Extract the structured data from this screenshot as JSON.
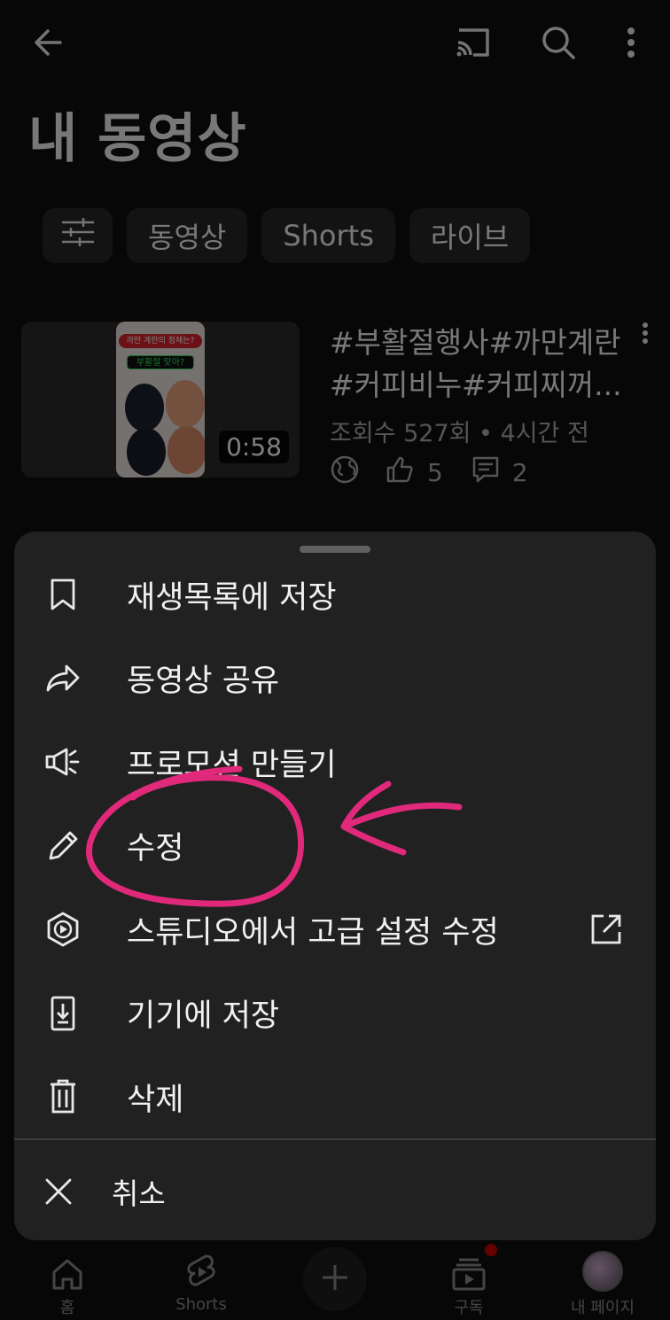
{
  "header": {
    "title": "내 동영상"
  },
  "chips": [
    "동영상",
    "Shorts",
    "라이브"
  ],
  "videos": [
    {
      "thumbnail_caption_1": "까만 계란의 정체는?",
      "thumbnail_caption_2": "부활절  맞아?",
      "duration": "0:58",
      "title": "#부활절행사#까만계란#커피비누#커피찌꺼...",
      "meta": "조회수 527회 • 4시간 전",
      "likes": "5",
      "comments": "2"
    }
  ],
  "menu": {
    "items": [
      {
        "label": "재생목록에 저장",
        "icon": "bookmark-icon"
      },
      {
        "label": "동영상 공유",
        "icon": "share-icon"
      },
      {
        "label": "프로모션 만들기",
        "icon": "megaphone-icon"
      },
      {
        "label": "수정",
        "icon": "pencil-icon"
      },
      {
        "label": "스튜디오에서 고급 설정 수정",
        "icon": "studio-icon"
      },
      {
        "label": "기기에 저장",
        "icon": "download-device-icon"
      },
      {
        "label": "삭제",
        "icon": "trash-icon"
      }
    ],
    "cancel_label": "취소"
  },
  "bottom_nav": {
    "home": "홈",
    "shorts": "Shorts",
    "subscriptions": "구독",
    "my_page": "내 페이지"
  },
  "colors": {
    "background": "#0f0f0f",
    "sheet": "#212121",
    "chip": "#272727",
    "annotation": "#e0297a",
    "notification": "#cc0000"
  }
}
